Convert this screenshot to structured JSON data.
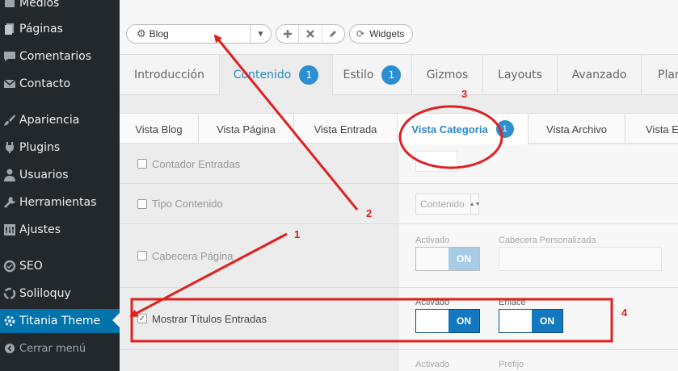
{
  "sidebar": {
    "items": [
      {
        "label": "Medios",
        "icon": "media-icon"
      },
      {
        "label": "Páginas",
        "icon": "pages-icon"
      },
      {
        "label": "Comentarios",
        "icon": "comments-icon"
      },
      {
        "label": "Contacto",
        "icon": "mail-icon"
      },
      {
        "label": "Apariencia",
        "icon": "brush-icon"
      },
      {
        "label": "Plugins",
        "icon": "plugin-icon"
      },
      {
        "label": "Usuarios",
        "icon": "user-icon"
      },
      {
        "label": "Herramientas",
        "icon": "wrench-icon"
      },
      {
        "label": "Ajustes",
        "icon": "settings-icon"
      },
      {
        "label": "SEO",
        "icon": "seo-icon"
      },
      {
        "label": "Soliloquy",
        "icon": "soliloquy-icon"
      },
      {
        "label": "Titania Theme",
        "icon": "gear-icon"
      }
    ],
    "collapse_label": "Cerrar menú"
  },
  "toolbar": {
    "layout_select": "Blog",
    "widgets_label": "Widgets"
  },
  "tabs": [
    {
      "label": "Introducción"
    },
    {
      "label": "Contenido",
      "badge": "1"
    },
    {
      "label": "Estilo",
      "badge": "1"
    },
    {
      "label": "Gizmos"
    },
    {
      "label": "Layouts"
    },
    {
      "label": "Avanzado"
    },
    {
      "label": "Plan"
    }
  ],
  "subtabs": [
    {
      "label": "Vista Blog"
    },
    {
      "label": "Vista Página"
    },
    {
      "label": "Vista Entrada"
    },
    {
      "label": "Vista Categoría",
      "badge": "1"
    },
    {
      "label": "Vista Archivo"
    },
    {
      "label": "Vista E"
    }
  ],
  "rows": {
    "contador": {
      "label": "Contador Entradas"
    },
    "tipo": {
      "label": "Tipo Contenido",
      "select_value": "Contenido"
    },
    "cabecera": {
      "label": "Cabecera Página",
      "activado_label": "Activado",
      "toggle_value": "ON",
      "custom_label": "Cabecera Personalizada"
    },
    "titulos": {
      "label": "Mostrar Títulos Entradas",
      "activado_label": "Activado",
      "toggle_value": "ON",
      "enlace_label": "Enlace",
      "enlace_value": "ON"
    },
    "next": {
      "activado_label": "Activado",
      "prefijo_label": "Prefijo"
    }
  },
  "annotations": {
    "n1": "1",
    "n2": "2",
    "n3": "3",
    "n4": "4",
    "color": "#e02020"
  },
  "colors": {
    "sidebar_bg": "#23282d",
    "active_bg": "#0073aa",
    "accent": "#2a86c5",
    "toggle_on": "#1478c0"
  }
}
